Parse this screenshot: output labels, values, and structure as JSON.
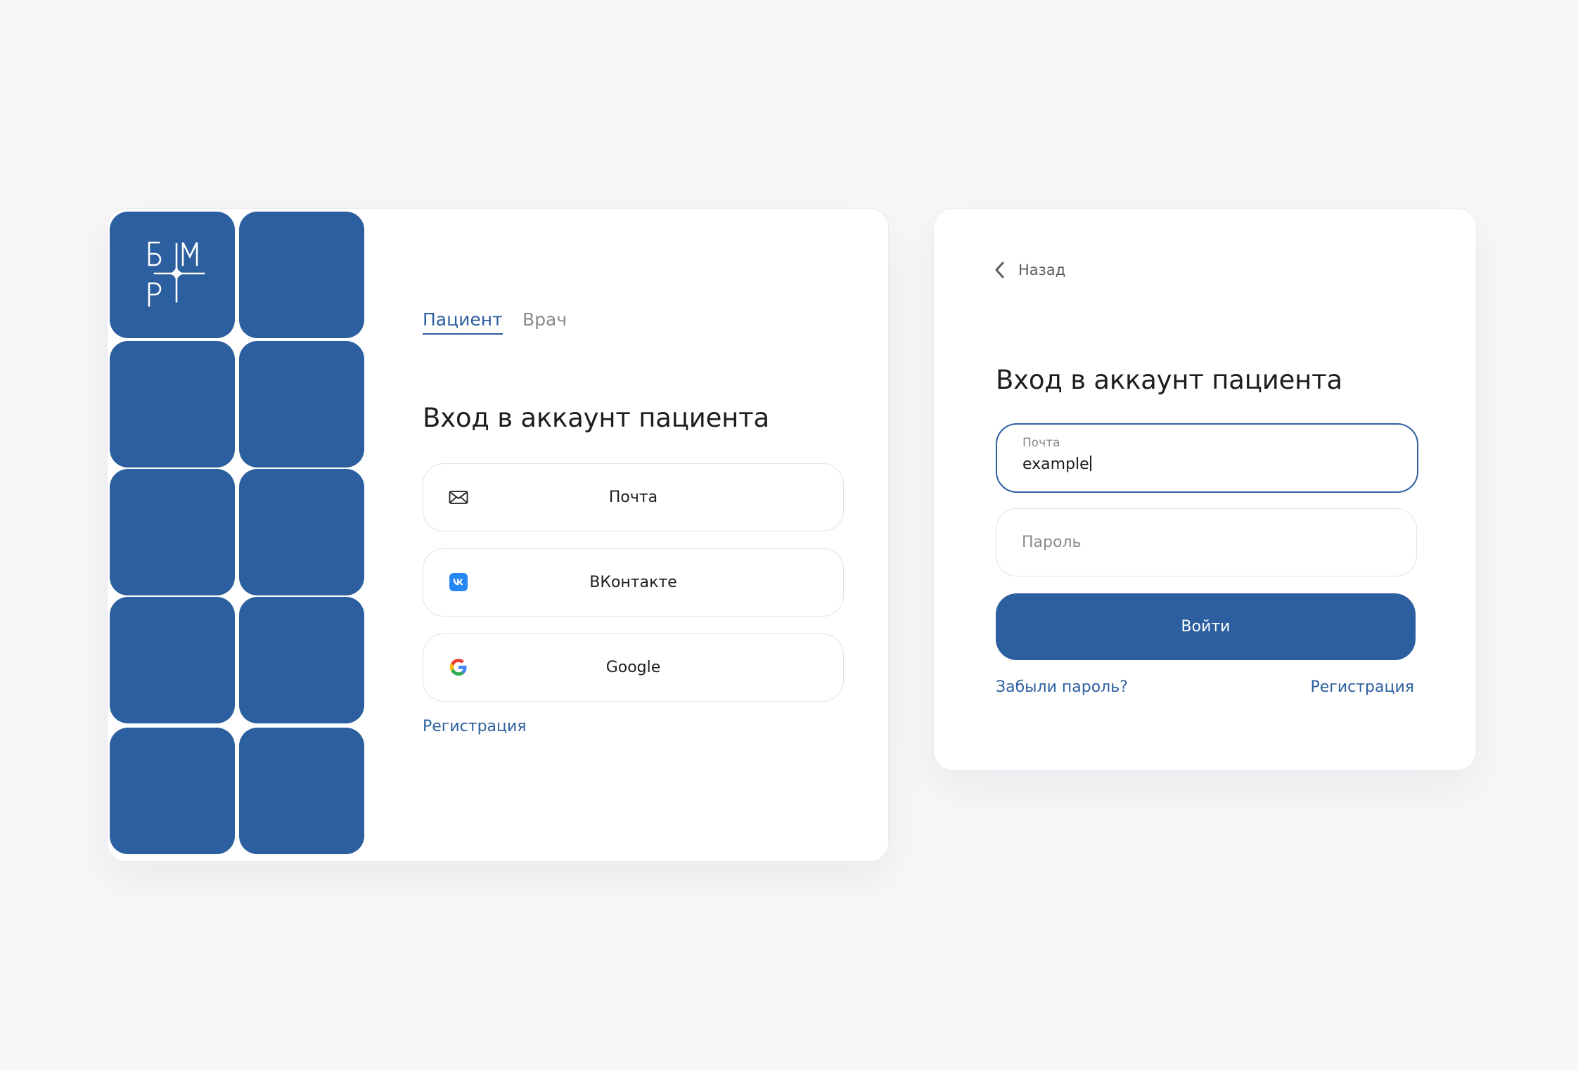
{
  "colors": {
    "brand": "#2c5f9f",
    "background": "#f7f7f8",
    "text": "#1d1d1f",
    "muted": "#8a8a8f"
  },
  "left_card": {
    "tabs": [
      {
        "label": "Пациент",
        "active": true
      },
      {
        "label": "Врач",
        "active": false
      }
    ],
    "heading": "Вход в аккаунт пациента",
    "methods": [
      {
        "label": "Почта",
        "icon": "envelope-icon"
      },
      {
        "label": "ВКонтакте",
        "icon": "vk-icon"
      },
      {
        "label": "Google",
        "icon": "google-icon"
      }
    ],
    "register_link": "Регистрация"
  },
  "right_card": {
    "back_label": "Назад",
    "heading": "Вход в аккаунт пациента",
    "email": {
      "label": "Почта",
      "value": "example"
    },
    "password": {
      "placeholder": "Пароль"
    },
    "submit_label": "Войти",
    "forgot_link": "Забыли пароль?",
    "register_link": "Регистрация"
  }
}
